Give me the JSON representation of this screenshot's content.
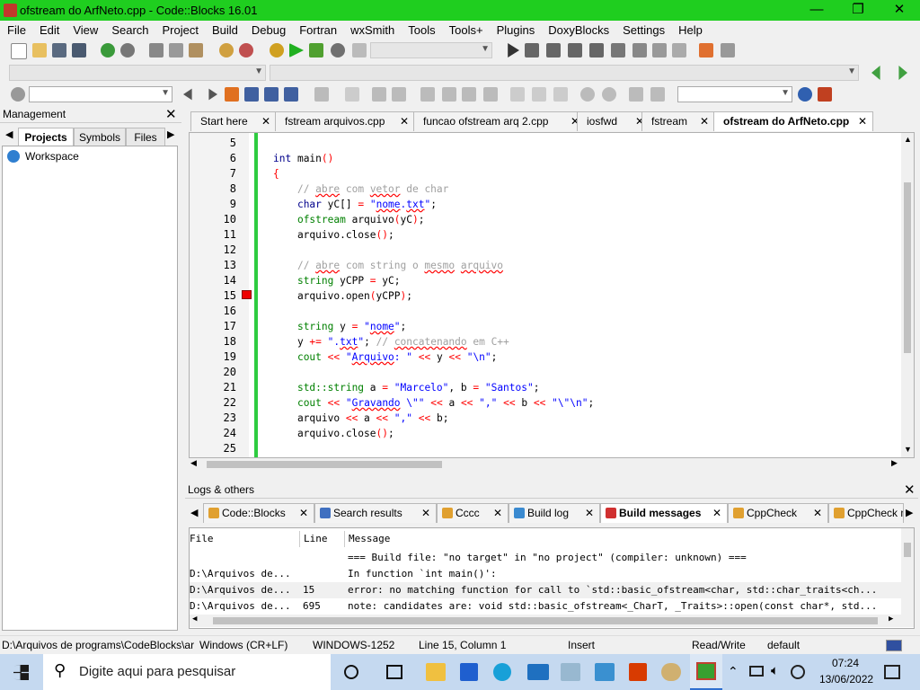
{
  "title": "ofstream do ArfNeto.cpp - Code::Blocks 16.01",
  "window_buttons": {
    "min": "—",
    "max": "❐",
    "close": "✕"
  },
  "menu": [
    "File",
    "Edit",
    "View",
    "Search",
    "Project",
    "Build",
    "Debug",
    "Fortran",
    "wxSmith",
    "Tools",
    "Tools+",
    "Plugins",
    "DoxyBlocks",
    "Settings",
    "Help"
  ],
  "management": {
    "title": "Management",
    "tabs": [
      "Projects",
      "Symbols",
      "Files"
    ],
    "tree_root": "Workspace"
  },
  "editor_tabs": [
    {
      "label": "Start here",
      "active": false
    },
    {
      "label": "fstream arquivos.cpp",
      "active": false
    },
    {
      "label": "funcao ofstream arq 2.cpp",
      "active": false
    },
    {
      "label": "iosfwd",
      "active": false
    },
    {
      "label": "fstream",
      "active": false
    },
    {
      "label": "ofstream do ArfNeto.cpp",
      "active": true
    }
  ],
  "code_lines": [
    {
      "n": "5",
      "html": ""
    },
    {
      "n": "6",
      "html": "<span class=\"kw\">int</span> main<span class=\"op\">()</span>"
    },
    {
      "n": "7",
      "html": "<span class=\"op\">{</span>"
    },
    {
      "n": "8",
      "html": "    <span class=\"cm\">// <span class=\"un\">abre</span> com <span class=\"un\">vetor</span> de char</span>"
    },
    {
      "n": "9",
      "html": "    <span class=\"kw\">char</span> yC[] <span class=\"op\">=</span> <span class=\"str\">\"<span class=\"un\">nome</span>.<span class=\"un\">txt</span>\"</span>;"
    },
    {
      "n": "10",
      "html": "    <span class=\"ty\">ofstream</span> arquivo<span class=\"op\">(</span>yC<span class=\"op\">)</span>;"
    },
    {
      "n": "11",
      "html": "    arquivo.close<span class=\"op\">()</span>;"
    },
    {
      "n": "12",
      "html": ""
    },
    {
      "n": "13",
      "html": "    <span class=\"cm\">// <span class=\"un\">abre</span> com string o <span class=\"un\">mesmo</span> <span class=\"un\">arquivo</span></span>"
    },
    {
      "n": "14",
      "html": "    <span class=\"ty\">string</span> yCPP <span class=\"op\">=</span> yC;"
    },
    {
      "n": "15",
      "html": "    arquivo.open<span class=\"op\">(</span>yCPP<span class=\"op\">)</span>;"
    },
    {
      "n": "16",
      "html": ""
    },
    {
      "n": "17",
      "html": "    <span class=\"ty\">string</span> y <span class=\"op\">=</span> <span class=\"str\">\"<span class=\"un\">nome</span>\"</span>;"
    },
    {
      "n": "18",
      "html": "    y <span class=\"op\">+=</span> <span class=\"str\">\".<span class=\"un\">txt</span>\"</span>; <span class=\"cm\">// <span class=\"un\">concatenando</span> em C++</span>"
    },
    {
      "n": "19",
      "html": "    <span class=\"ty\">cout</span> <span class=\"op\">&lt;&lt;</span> <span class=\"str\">\"<span class=\"un\">Arquivo</span>: \"</span> <span class=\"op\">&lt;&lt;</span> y <span class=\"op\">&lt;&lt;</span> <span class=\"str\">\"\\n\"</span>;"
    },
    {
      "n": "20",
      "html": ""
    },
    {
      "n": "21",
      "html": "    <span class=\"ty\">std::string</span> a <span class=\"op\">=</span> <span class=\"str\">\"Marcelo\"</span>, b <span class=\"op\">=</span> <span class=\"str\">\"Santos\"</span>;"
    },
    {
      "n": "22",
      "html": "    <span class=\"ty\">cout</span> <span class=\"op\">&lt;&lt;</span> <span class=\"str\">\"<span class=\"un\">Gravando</span> \\\"\"</span> <span class=\"op\">&lt;&lt;</span> a <span class=\"op\">&lt;&lt;</span> <span class=\"str\">\",\"</span> <span class=\"op\">&lt;&lt;</span> b <span class=\"op\">&lt;&lt;</span> <span class=\"str\">\"\\\"\\n\"</span>;"
    },
    {
      "n": "23",
      "html": "    arquivo <span class=\"op\">&lt;&lt;</span> a <span class=\"op\">&lt;&lt;</span> <span class=\"str\">\",\"</span> <span class=\"op\">&lt;&lt;</span> b;"
    },
    {
      "n": "24",
      "html": "    arquivo.close<span class=\"op\">()</span>;"
    },
    {
      "n": "25",
      "html": ""
    }
  ],
  "logs": {
    "title": "Logs & others",
    "tabs": [
      {
        "label": "Code::Blocks",
        "active": false,
        "icon_color": "#e0a030"
      },
      {
        "label": "Search results",
        "active": false,
        "icon_color": "#4070c0"
      },
      {
        "label": "Cccc",
        "active": false,
        "icon_color": "#e0a030"
      },
      {
        "label": "Build log",
        "active": false,
        "icon_color": "#3a8ad0"
      },
      {
        "label": "Build messages",
        "active": true,
        "icon_color": "#d03030"
      },
      {
        "label": "CppCheck",
        "active": false,
        "icon_color": "#e0a030"
      },
      {
        "label": "CppCheck m",
        "active": false,
        "icon_color": "#e0a030"
      }
    ],
    "columns": [
      "File",
      "Line",
      "Message"
    ],
    "rows": [
      {
        "file": "",
        "line": "",
        "message": "=== Build file: \"no target\" in \"no project\" (compiler: unknown) ==="
      },
      {
        "file": "D:\\Arquivos de...",
        "line": "",
        "message": "In function `int main()':"
      },
      {
        "file": "D:\\Arquivos de...",
        "line": "15",
        "message": "error: no matching function for call to `std::basic_ofstream<char, std::char_traits<ch..."
      },
      {
        "file": "D:\\Arquivos de...",
        "line": "695",
        "message": "note: candidates are: void std::basic_ofstream<_CharT, _Traits>::open(const char*, std..."
      }
    ]
  },
  "status": {
    "path": "D:\\Arquivos de programs\\CodeBlocks\\ar",
    "eol": "Windows (CR+LF)",
    "encoding": "WINDOWS-1252",
    "position": "Line 15, Column 1",
    "mode": "Insert",
    "access": "Read/Write",
    "lexer": "default"
  },
  "taskbar": {
    "search_placeholder": "Digite aqui para pesquisar",
    "time": "07:24",
    "date": "13/06/2022"
  }
}
